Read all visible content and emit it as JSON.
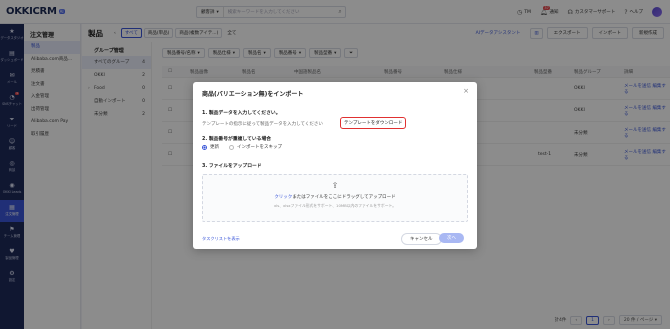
{
  "topbar": {
    "logo": "OKKICRM",
    "logo_badge": "AI",
    "search_scope": "顧客詳",
    "search_placeholder": "検索キーワードを入力してください",
    "items": [
      {
        "icon": "clock-icon",
        "label": "TM"
      },
      {
        "icon": "bell-icon",
        "label": "通知",
        "badge": "37"
      },
      {
        "icon": "headset-icon",
        "label": "カスタマーサポート"
      },
      {
        "icon": "help-icon",
        "label": "ヘルプ"
      }
    ]
  },
  "rail": [
    {
      "icon": "star-icon",
      "label": "データスタジオ"
    },
    {
      "icon": "chart-icon",
      "label": "ダッシュボード"
    },
    {
      "icon": "mail-icon",
      "label": "メール"
    },
    {
      "icon": "chat-icon",
      "label": "SNSチャット",
      "badge": "1"
    },
    {
      "icon": "funnel-icon",
      "label": "リード"
    },
    {
      "icon": "user-icon",
      "label": "顧客"
    },
    {
      "icon": "deal-icon",
      "label": "商談"
    },
    {
      "icon": "okki-icon",
      "label": "OKKI Leads"
    },
    {
      "icon": "order-icon",
      "label": "注文管理"
    },
    {
      "icon": "team-icon",
      "label": "チーム管理"
    },
    {
      "icon": "heart-icon",
      "label": "製品管理"
    },
    {
      "icon": "settings-icon",
      "label": "設定"
    }
  ],
  "subnav": {
    "title": "注文管理",
    "items": [
      "製品",
      "Alibaba.com商品...",
      "見積書",
      "注文書",
      "入金管理",
      "出荷管理",
      "Alibaba.com Pay",
      "取引履歴"
    ],
    "active_index": 0
  },
  "main": {
    "title": "製品",
    "tabs": [
      "すべて",
      "商品(単品)",
      "商品(複数アイテ...)",
      "全て"
    ],
    "ai_link": "AIデータアシスタント",
    "export": "エクスポート",
    "import": "インポート",
    "new": "新規作成"
  },
  "groups": {
    "title": "グループ管理",
    "items": [
      {
        "name": "すべてのグループ",
        "count": "4"
      },
      {
        "name": "OKKI",
        "count": "2"
      },
      {
        "name": "Food",
        "count": "0"
      },
      {
        "name": "自動インポート",
        "count": "0"
      },
      {
        "name": "未分類",
        "count": "2"
      }
    ]
  },
  "filters": [
    "製品番号/名称",
    "製品仕様",
    "製品名",
    "製品番号",
    "製品型番"
  ],
  "table": {
    "headers": [
      "",
      "製品画像",
      "製品名",
      "中国語製品名",
      "製品番号",
      "製品仕様",
      "製品型番",
      "製品グループ",
      "詳細"
    ],
    "rows": [
      {
        "model": "--",
        "group": "OKKI",
        "actions": [
          "メールを送信",
          "編集する"
        ]
      },
      {
        "model": "--",
        "group": "OKKI",
        "actions": [
          "メールを送信",
          "編集する"
        ]
      },
      {
        "model": "--",
        "group": "未分類",
        "actions": [
          "メールを送信",
          "編集する"
        ]
      },
      {
        "model": "test-1",
        "group": "未分類",
        "actions": [
          "メールを送信",
          "編集する"
        ]
      }
    ]
  },
  "pager": {
    "total": "計4件",
    "page": "1",
    "size": "20 件 / ページ"
  },
  "modal": {
    "title": "商品(バリエーション無)をインポート",
    "step1_title": "1. 製品データを入力してください。",
    "step1_desc": "テンプレートの指示に従って製品データを入力してください",
    "download_button": "テンプレートをダウンロード",
    "step2_title": "2. 製品番号が重複している場合",
    "radio_update": "更新",
    "radio_skip": "インポートをスキップ",
    "step3_title": "3. ファイルをアップロード",
    "upload_link": "クリック",
    "upload_text": "またはファイルをここにドラッグしてアップロード",
    "upload_sub": "xls、xlsxファイル形式をサポート、10MB以内のファイルをサポート。",
    "task_link": "タスクリストを表示",
    "cancel": "キャンセル",
    "next": "次へ"
  }
}
